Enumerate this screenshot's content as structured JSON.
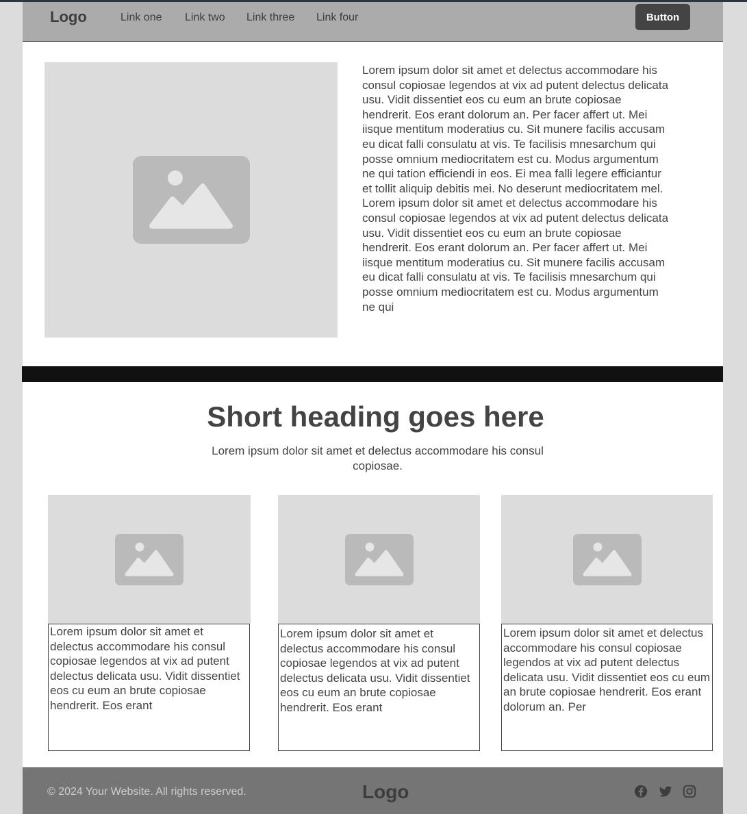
{
  "header": {
    "logo": "Logo",
    "nav": [
      "Link one",
      "Link two",
      "Link three",
      "Link four"
    ],
    "button_label": "Button"
  },
  "hero": {
    "text": "Lorem ipsum dolor sit amet et delectus accommodare his consul copiosae legendos at vix ad putent delectus delicata usu. Vidit dissentiet eos cu eum an brute copiosae hendrerit. Eos erant dolorum an. Per facer affert ut. Mei iisque mentitum moderatius cu. Sit munere facilis accusam eu dicat falli consulatu at vis. Te facilisis mnesarchum qui posse omnium mediocritatem est cu. Modus argumentum ne qui tation efficiendi in eos. Ei mea falli legere efficiantur et tollit aliquip debitis mei. No deserunt mediocritatem mel. Lorem ipsum dolor sit amet et delectus accommodare his consul copiosae legendos at vix ad putent delectus delicata usu. Vidit dissentiet eos cu eum an brute copiosae hendrerit. Eos erant dolorum an. Per facer affert ut. Mei iisque mentitum moderatius cu. Sit munere facilis accusam eu dicat falli consulatu at vis. Te facilisis mnesarchum qui posse omnium mediocritatem est cu. Modus argumentum ne qui",
    "image_icon": "image-placeholder-icon"
  },
  "section": {
    "heading": "Short heading goes here",
    "subheading": "Lorem ipsum dolor sit amet et delectus accommodare his consul copiosae."
  },
  "cards": [
    {
      "text": "Lorem ipsum dolor sit amet et delectus accommodare his consul copiosae legendos at vix ad putent delectus delicata usu. Vidit dissentiet eos cu eum an brute copiosae hendrerit. Eos erant"
    },
    {
      "text": "Lorem ipsum dolor sit amet et delectus accommodare his consul copiosae legendos at vix ad putent delectus delicata usu. Vidit dissentiet eos cu eum an brute copiosae hendrerit. Eos erant"
    },
    {
      "text": "Lorem ipsum dolor sit amet et delectus accommodare his consul copiosae legendos at vix ad putent delectus delicata usu. Vidit dissentiet eos cu eum an brute copiosae hendrerit. Eos erant dolorum an. Per"
    }
  ],
  "footer": {
    "copyright": "© 2024 Your Website. All rights reserved.",
    "logo": "Logo",
    "social": [
      "facebook-icon",
      "twitter-icon",
      "instagram-icon"
    ]
  },
  "colors": {
    "header_bg": "#ababab",
    "footer_bg": "#757575",
    "placeholder_bg": "#dcdcdc",
    "button_bg": "#444444"
  }
}
